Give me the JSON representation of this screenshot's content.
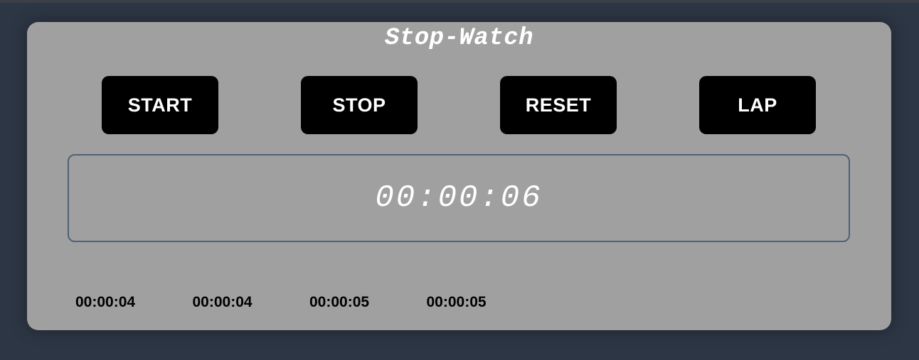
{
  "app": {
    "title": "Stop-Watch"
  },
  "controls": {
    "start_label": "START",
    "stop_label": "STOP",
    "reset_label": "RESET",
    "lap_label": "LAP"
  },
  "display": {
    "time": "00:00:06"
  },
  "laps": [
    "00:00:04",
    "00:00:04",
    "00:00:05",
    "00:00:05"
  ],
  "colors": {
    "page_background": "#2d3644",
    "card_background": "#a0a0a0",
    "button_background": "#000000",
    "button_text": "#ffffff",
    "display_border": "#506078"
  }
}
